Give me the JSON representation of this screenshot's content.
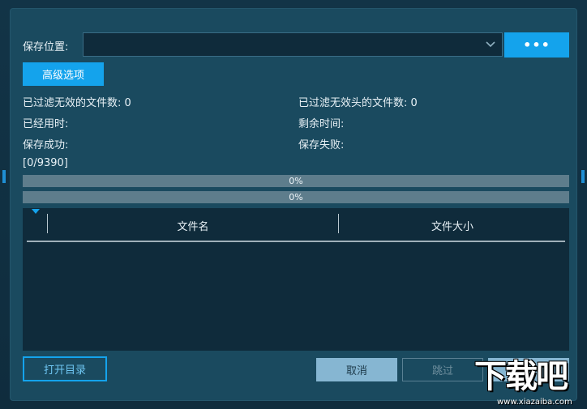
{
  "dialog": {
    "save_location_label": "保存位置:",
    "save_location_value": "",
    "browse_label": "•••",
    "advanced_options_label": "高级选项"
  },
  "stats": {
    "filtered_invalid_label": "已过滤无效的文件数:",
    "filtered_invalid_value": "0",
    "filtered_no_header_label": "已过滤无效头的文件数:",
    "filtered_no_header_value": "0",
    "elapsed_label": "已经用时:",
    "elapsed_value": "",
    "remaining_label": "剩余时间:",
    "remaining_value": "",
    "success_label": "保存成功:",
    "success_value": "",
    "failed_label": "保存失败:",
    "failed_value": "",
    "counter": "[0/9390]"
  },
  "progress": [
    {
      "label": "0%",
      "fraction": 0
    },
    {
      "label": "0%",
      "fraction": 0
    }
  ],
  "table": {
    "columns": [
      "文件名",
      "文件大小"
    ],
    "rows": []
  },
  "buttons": {
    "open_dir": "打开目录",
    "cancel": "取消",
    "skip": "跳过",
    "ok": ""
  },
  "watermark": {
    "logo_text": "下载吧",
    "url": "www.xiazaiba.com"
  },
  "background": {
    "col1": "",
    "col2": "",
    "col3": ""
  },
  "colors": {
    "accent": "#14a3ec",
    "dialog_bg": "#1a4a5f",
    "panel_bg": "#0f2b3b"
  }
}
